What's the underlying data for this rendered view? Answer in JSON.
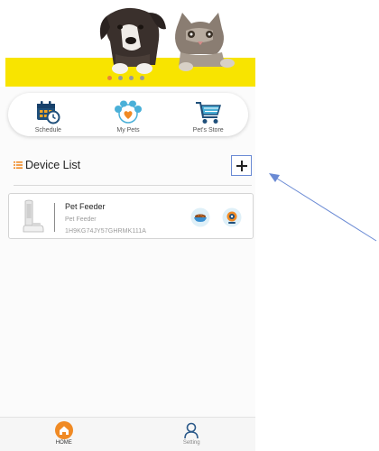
{
  "banner": {
    "slide_count": 4,
    "active_slide": 1
  },
  "shortcuts": [
    {
      "label": "Schedule",
      "icon": "calendar-clock-icon"
    },
    {
      "label": "My Pets",
      "icon": "paw-heart-icon"
    },
    {
      "label": "Pet's Store",
      "icon": "shopping-cart-icon"
    }
  ],
  "device_list": {
    "title": "Device List",
    "add_symbol": "+",
    "devices": [
      {
        "name": "Pet Feeder",
        "type": "Pet Feeder",
        "id": "1H9KG74JY57GHRMK111A"
      }
    ]
  },
  "tabbar": {
    "home": "HOME",
    "setting": "Setting"
  },
  "colors": {
    "accent": "#f08a24",
    "banner": "#f8e400",
    "arrow": "#6a8ad4"
  }
}
